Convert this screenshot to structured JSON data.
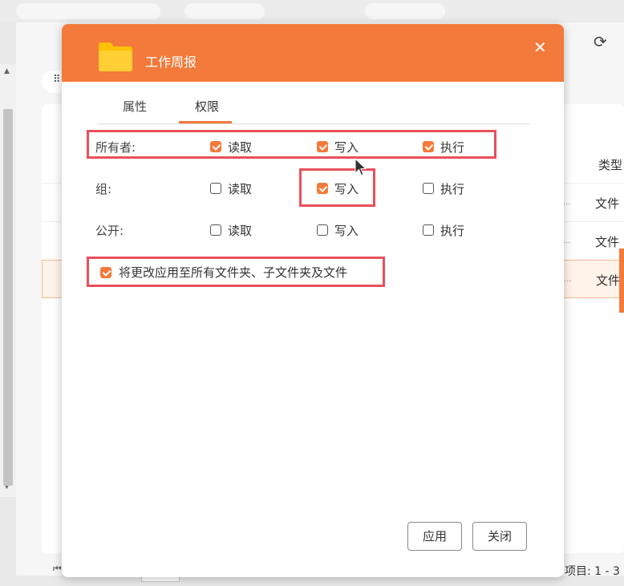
{
  "background": {
    "column_header": "类型",
    "rows": [
      {
        "type": "文件",
        "dots": "..."
      },
      {
        "type": "文件",
        "dots": "..."
      },
      {
        "type": "文件",
        "dots": "..."
      }
    ],
    "status": "项目: 1 - 3"
  },
  "dialog": {
    "title": "工作周报",
    "tabs": [
      "属性",
      "权限"
    ],
    "active_tab": "权限",
    "permissions": [
      {
        "label": "所有者:",
        "read": {
          "label": "读取",
          "checked": true
        },
        "write": {
          "label": "写入",
          "checked": true
        },
        "exec": {
          "label": "执行",
          "checked": true
        }
      },
      {
        "label": "组:",
        "read": {
          "label": "读取",
          "checked": false
        },
        "write": {
          "label": "写入",
          "checked": true
        },
        "exec": {
          "label": "执行",
          "checked": false
        }
      },
      {
        "label": "公开:",
        "read": {
          "label": "读取",
          "checked": false
        },
        "write": {
          "label": "写入",
          "checked": false
        },
        "exec": {
          "label": "执行",
          "checked": false
        }
      }
    ],
    "apply_recursive": {
      "label": "将更改应用至所有文件夹、子文件夹及文件",
      "checked": true
    },
    "buttons": {
      "apply": "应用",
      "close": "关闭"
    }
  },
  "colors": {
    "accent": "#f37a3a",
    "highlight": "#e8505b",
    "folder": "#ffc107"
  }
}
